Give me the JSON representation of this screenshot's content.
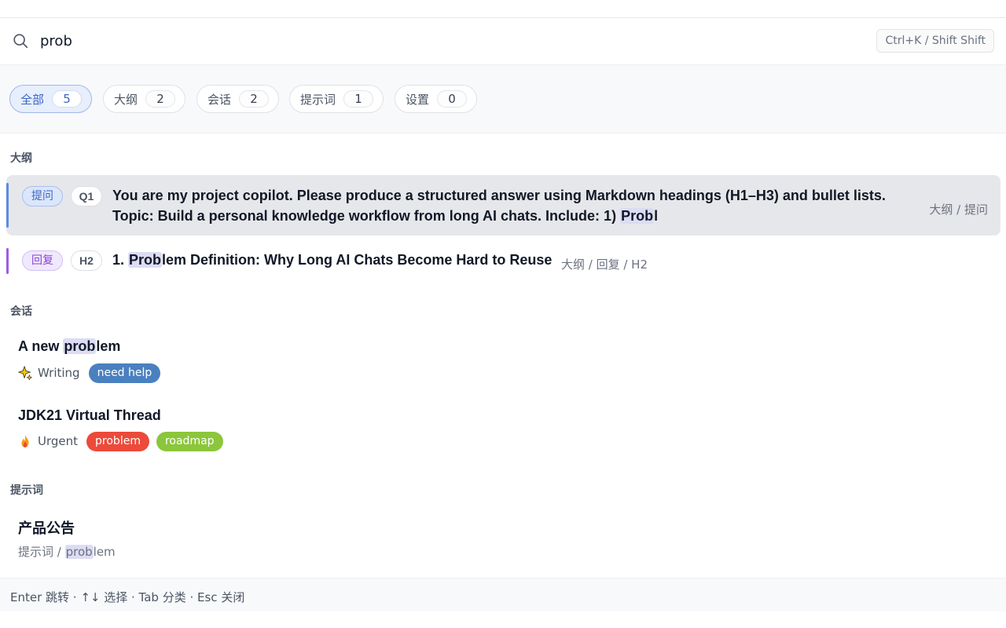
{
  "search": {
    "query": "prob",
    "shortcut_hint": "Ctrl+K / Shift Shift"
  },
  "filters": [
    {
      "label": "全部",
      "count": "5",
      "active": true
    },
    {
      "label": "大纲",
      "count": "2",
      "active": false
    },
    {
      "label": "会话",
      "count": "2",
      "active": false
    },
    {
      "label": "提示词",
      "count": "1",
      "active": false
    },
    {
      "label": "设置",
      "count": "0",
      "active": false
    }
  ],
  "sections": {
    "outline": {
      "label": "大纲",
      "items": [
        {
          "role": "提问",
          "level": "Q1",
          "line1": "You are my project copilot. Please produce a structured answer using Markdown headings (H1–H3) and bullet lists.",
          "line2_before": "Topic: Build a personal knowledge workflow from long AI chats. Include: 1) ",
          "line2_match": "Prob",
          "line2_after": "l",
          "path": "大纲 / 提问"
        },
        {
          "role": "回复",
          "level": "H2",
          "text_before": "1. ",
          "text_match": "Prob",
          "text_after": "lem Definition: Why Long AI Chats Become Hard to Reuse",
          "path": "大纲 / 回复 / H2"
        }
      ]
    },
    "conversations": {
      "label": "会话",
      "items": [
        {
          "title_before": "A new ",
          "title_match": "prob",
          "title_after": "lem",
          "folder_icon": "sparkle-icon",
          "folder": "Writing",
          "tags": [
            {
              "label": "need help",
              "color": "#4a80bf"
            }
          ]
        },
        {
          "title": "JDK21 Virtual Thread",
          "folder_icon": "fire-icon",
          "folder": "Urgent",
          "tags": [
            {
              "label": "problem",
              "color": "#ec4a3a"
            },
            {
              "label": "roadmap",
              "color": "#8cc63c"
            }
          ]
        }
      ]
    },
    "prompts": {
      "label": "提示词",
      "items": [
        {
          "title": "产品公告",
          "path_before": "提示词 / ",
          "path_match": "prob",
          "path_after": "lem"
        }
      ]
    }
  },
  "footer": {
    "hint": "Enter 跳转 · ↑↓ 选择 · Tab 分类 · Esc 关闭"
  },
  "colors": {
    "accent_blue": "#3b64c5",
    "accent_purple": "#8b45d9",
    "highlight": "#dcdcf3"
  }
}
